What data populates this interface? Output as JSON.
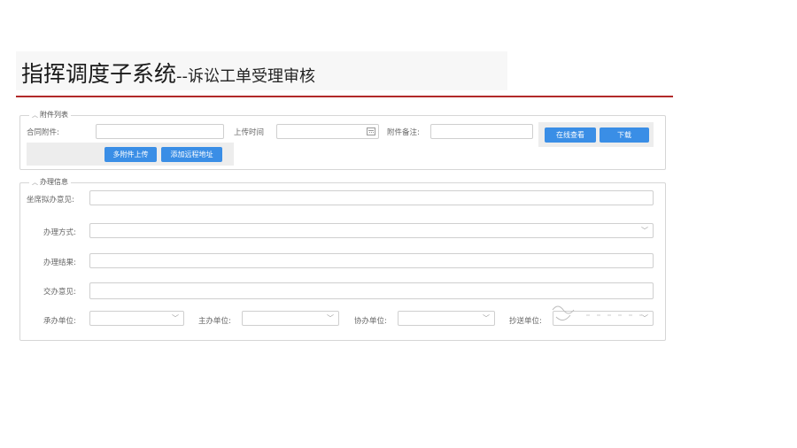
{
  "header": {
    "title_main": "指挥调度子系统",
    "title_sub": "--诉讼工单受理审核"
  },
  "attachments": {
    "legend": "附件列表",
    "contract_label": "合同附件:",
    "contract_value": "",
    "upload_time_label": "上传时间",
    "upload_time_value": "",
    "note_label": "附件备注:",
    "note_value": "",
    "view_online_button": "在线查看",
    "download_button": "下载",
    "multi_upload_button": "多附件上传",
    "add_remote_button": "添加远程地址"
  },
  "handling": {
    "legend": "办理信息",
    "seat_opinion_label": "坐席拟办意见:",
    "seat_opinion_value": "",
    "method_label": "办理方式:",
    "method_value": "",
    "result_label": "办理结果:",
    "result_value": "",
    "transfer_opinion_label": "交办意见:",
    "transfer_opinion_value": "",
    "undertaking_unit_label": "承办单位:",
    "undertaking_unit_value": "",
    "lead_unit_label": "主办单位:",
    "lead_unit_value": "",
    "assist_unit_label": "协办单位:",
    "assist_unit_value": "",
    "cc_unit_label": "抄送单位:",
    "cc_unit_value": ""
  },
  "icons": {
    "caret": "collapse-caret-icon",
    "chevron": "chevron-down-icon",
    "calendar": "calendar-icon"
  },
  "colors": {
    "accent_button": "#3a8ee6",
    "title_rule": "#b22a2a"
  }
}
